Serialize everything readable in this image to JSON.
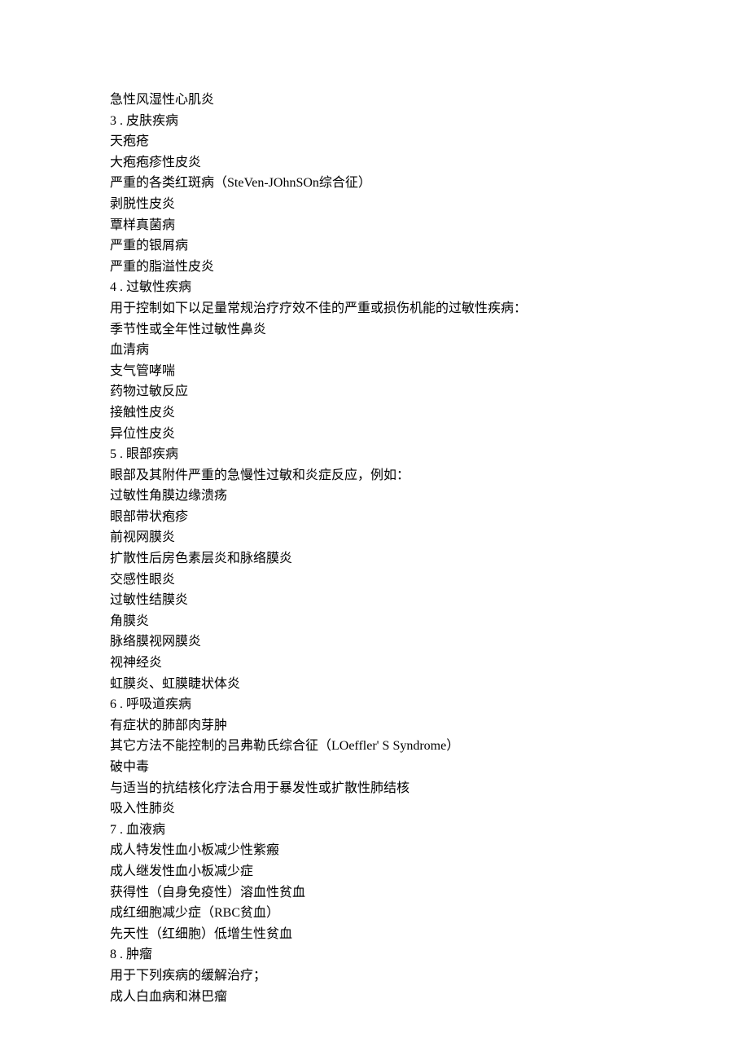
{
  "lines": [
    "急性风湿性心肌炎",
    "3 . 皮肤疾病",
    "天疱疮",
    "大疱疱疹性皮炎",
    "严重的各类红斑病（SteVen-JOhnSOn综合征）",
    "剥脱性皮炎",
    "覃样真菌病",
    "严重的银屑病",
    "严重的脂溢性皮炎",
    "4 . 过敏性疾病",
    "用于控制如下以足量常规治疗疗效不佳的严重或损伤机能的过敏性疾病：",
    "季节性或全年性过敏性鼻炎",
    "血清病",
    "支气管哮喘",
    "药物过敏反应",
    "接触性皮炎",
    "异位性皮炎",
    "5 . 眼部疾病",
    "眼部及其附件严重的急慢性过敏和炎症反应，例如：",
    "过敏性角膜边缘溃疡",
    "眼部带状疱疹",
    "前视网膜炎",
    "扩散性后房色素层炎和脉络膜炎",
    "交感性眼炎",
    "过敏性结膜炎",
    "角膜炎",
    "脉络膜视网膜炎",
    "视神经炎",
    "虹膜炎、虹膜睫状体炎",
    "6 . 呼吸道疾病",
    "有症状的肺部肉芽肿",
    "其它方法不能控制的吕弗勒氏综合征（LOeffler' S Syndrome）",
    "破中毒",
    "与适当的抗结核化疗法合用于暴发性或扩散性肺结核",
    "吸入性肺炎",
    "7 . 血液病",
    "成人特发性血小板减少性紫瘢",
    "成人继发性血小板减少症",
    "获得性（自身免疫性）溶血性贫血",
    "成红细胞减少症（RBC贫血）",
    "先天性（红细胞）低增生性贫血",
    "8 . 肿瘤",
    "用于下列疾病的缓解治疗；",
    "成人白血病和淋巴瘤"
  ]
}
